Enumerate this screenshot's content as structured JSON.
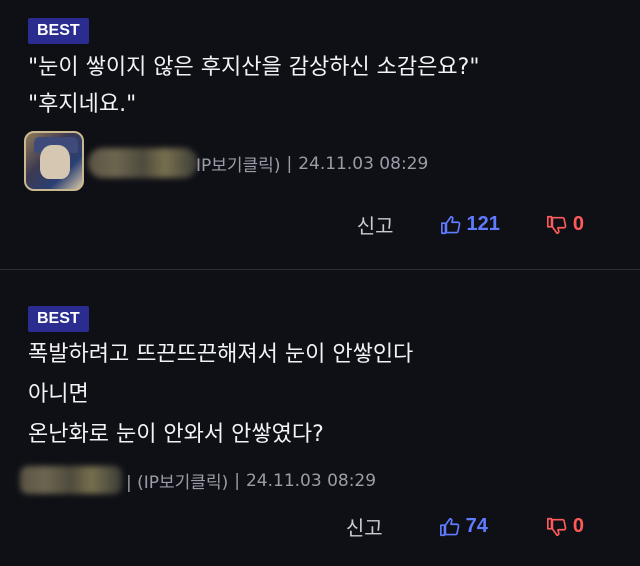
{
  "comments": [
    {
      "badge": "BEST",
      "lines": [
        "\"눈이 쌓이지 않은 후지산을 감상하신 소감은요?\"",
        "\"후지네요.\""
      ],
      "ip_label": "IP보기클릭)",
      "separator": "|",
      "timestamp": "24.11.03 08:29",
      "report_label": "신고",
      "upvotes": "121",
      "downvotes": "0"
    },
    {
      "badge": "BEST",
      "lines": [
        "폭발하려고 뜨끈뜨끈해져서 눈이 안쌓인다",
        "아니면",
        "온난화로 눈이 안와서 안쌓였다?"
      ],
      "ip_label": "| (IP보기클릭)",
      "separator": "|",
      "timestamp": "24.11.03 08:29",
      "report_label": "신고",
      "upvotes": "74",
      "downvotes": "0"
    }
  ],
  "colors": {
    "background": "#0f1016",
    "badge": "#2a2d8f",
    "upvote": "#5f7bff",
    "downvote": "#ff5a5a",
    "meta_text": "#9a9ca8"
  },
  "icons": {
    "upvote": "thumbs-up-icon",
    "downvote": "thumbs-down-icon"
  }
}
